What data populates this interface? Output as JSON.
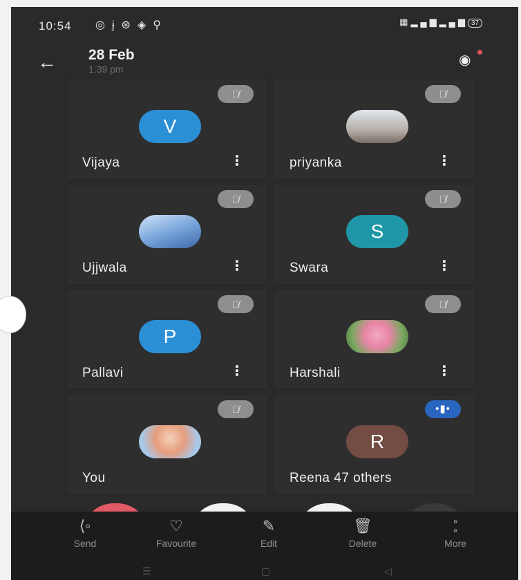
{
  "status_bar": {
    "time": "10:54",
    "left_icons": [
      "whatsapp-icon",
      "jio-icon",
      "network-icon",
      "chrome-icon",
      "accessibility-icon"
    ],
    "right_icons": [
      "volte-icon",
      "signal-4g-icon",
      "signal-icon",
      "battery-icon"
    ],
    "battery": "37"
  },
  "header": {
    "date": "28 Feb",
    "time": "1:39 pm"
  },
  "participants": [
    {
      "name": "Vijaya",
      "initial": "V",
      "avatar_color": "#2b8fd6",
      "mic": "muted"
    },
    {
      "name": "priyanka",
      "initial": "",
      "avatar_color": "#c9d3dc",
      "mic": "muted"
    },
    {
      "name": "Ujjwala",
      "initial": "",
      "avatar_color": "#5d89c7",
      "mic": "muted"
    },
    {
      "name": "Swara",
      "initial": "S",
      "avatar_color": "#1f97a8",
      "mic": "muted"
    },
    {
      "name": "Pallavi",
      "initial": "P",
      "avatar_color": "#2b8fd6",
      "mic": "muted"
    },
    {
      "name": "Harshali",
      "initial": "",
      "avatar_color": "#e6a3b8",
      "mic": "muted"
    },
    {
      "name": "You",
      "initial": "",
      "avatar_color": "#9ac0e6",
      "mic": "muted"
    },
    {
      "name": "Reena 47 others",
      "initial": "R",
      "avatar_color": "#734c44",
      "mic": "speaking"
    }
  ],
  "bottom_actions": [
    {
      "label": "Send",
      "icon": "share-icon"
    },
    {
      "label": "Favourite",
      "icon": "heart-icon"
    },
    {
      "label": "Edit",
      "icon": "edit-icon"
    },
    {
      "label": "Delete",
      "icon": "trash-icon"
    },
    {
      "label": "More",
      "icon": "more-dots-icon"
    }
  ],
  "colors": {
    "background": "#2a2a2a",
    "tile": "#2e2e2e",
    "mute_chip": "#8e8e8e",
    "speaking_chip": "#2a65c0",
    "bottom_bar": "#1c1c1c"
  }
}
